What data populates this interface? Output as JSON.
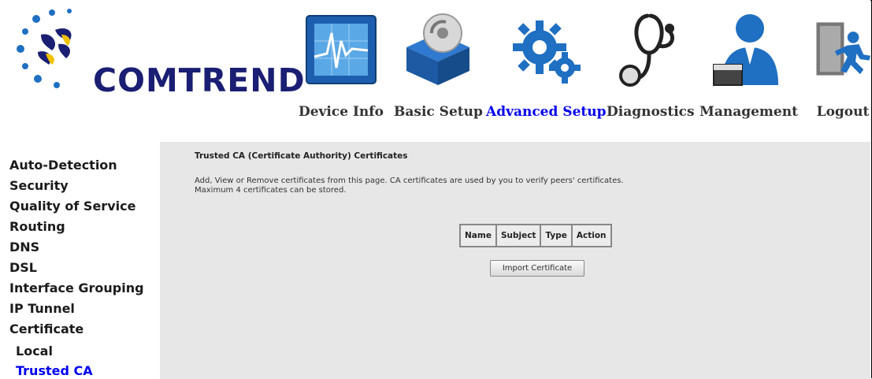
{
  "brand": {
    "name": "COMTREND"
  },
  "nav": [
    {
      "label": "Device Info",
      "icon": "device-info-icon",
      "active": false
    },
    {
      "label": "Basic Setup",
      "icon": "basic-setup-icon",
      "active": false
    },
    {
      "label": "Advanced Setup",
      "icon": "advanced-setup-icon",
      "active": true
    },
    {
      "label": "Diagnostics",
      "icon": "diagnostics-icon",
      "active": false
    },
    {
      "label": "Management",
      "icon": "management-icon",
      "active": false
    },
    {
      "label": "Logout",
      "icon": "logout-icon",
      "active": false
    }
  ],
  "sidebar": {
    "items": [
      {
        "label": "Auto-Detection"
      },
      {
        "label": "Security"
      },
      {
        "label": "Quality of Service"
      },
      {
        "label": "Routing"
      },
      {
        "label": "DNS"
      },
      {
        "label": "DSL"
      },
      {
        "label": "Interface Grouping"
      },
      {
        "label": "IP Tunnel"
      },
      {
        "label": "Certificate"
      },
      {
        "label": "Local"
      },
      {
        "label": "Trusted CA"
      }
    ],
    "active": "Trusted CA"
  },
  "main": {
    "title": "Trusted CA (Certificate Authority) Certificates",
    "description_line1": "Add, View or Remove certificates from this page. CA certificates are used by you to verify peers' certificates.",
    "description_line2": "Maximum 4 certificates can be stored.",
    "table": {
      "columns": [
        "Name",
        "Subject",
        "Type",
        "Action"
      ],
      "rows": []
    },
    "import_button": "Import Certificate"
  },
  "colors": {
    "active_link": "#0000ee",
    "panel_bg": "#e7e7e7",
    "brand_navy": "#1a1f73",
    "icon_blue": "#1f6fc2"
  }
}
